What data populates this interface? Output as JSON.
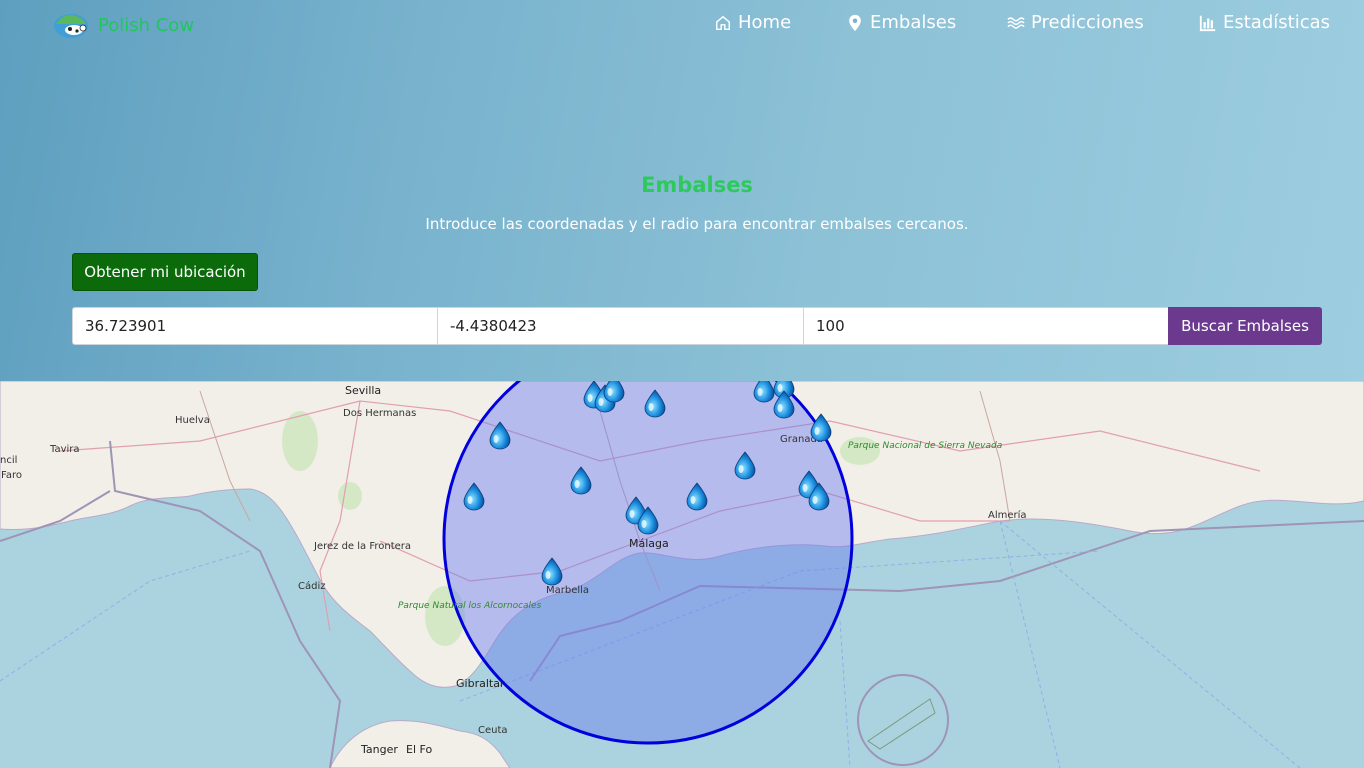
{
  "brand": {
    "name": "Polish Cow"
  },
  "nav": {
    "home": "Home",
    "embalses": "Embalses",
    "predicciones": "Predicciones",
    "estadisticas": "Estadísticas"
  },
  "hero": {
    "title": "Embalses",
    "subtitle": "Introduce las coordenadas y el radio para encontrar embalses cercanos."
  },
  "form": {
    "location_button": "Obtener mi ubicación",
    "latitude": "36.723901",
    "longitude": "-4.4380423",
    "radius": "100",
    "search_button": "Buscar Embalses"
  },
  "map": {
    "cities": {
      "sevilla": "Sevilla",
      "dos_hermanas": "Dos Hermanas",
      "huelva": "Huelva",
      "tavira": "Tavira",
      "faro": "Faro",
      "ncil": "ncil",
      "jerez": "Jerez de la Frontera",
      "cadiz": "Cádiz",
      "malaga": "Málaga",
      "marbella": "Marbella",
      "granada": "Granada",
      "almeria": "Almería",
      "gibraltar": "Gibraltar",
      "ceuta": "Ceuta",
      "tanger": "Tanger",
      "el_fo": "El Fo"
    },
    "parks": {
      "sierra_nevada": "Parque Nacional de Sierra Nevada",
      "alcornocales": "Parque Natural los Alcornocales"
    },
    "circle_color": "#0000dd",
    "circle_fill": "#6a7cf0",
    "marker_count": 18
  }
}
